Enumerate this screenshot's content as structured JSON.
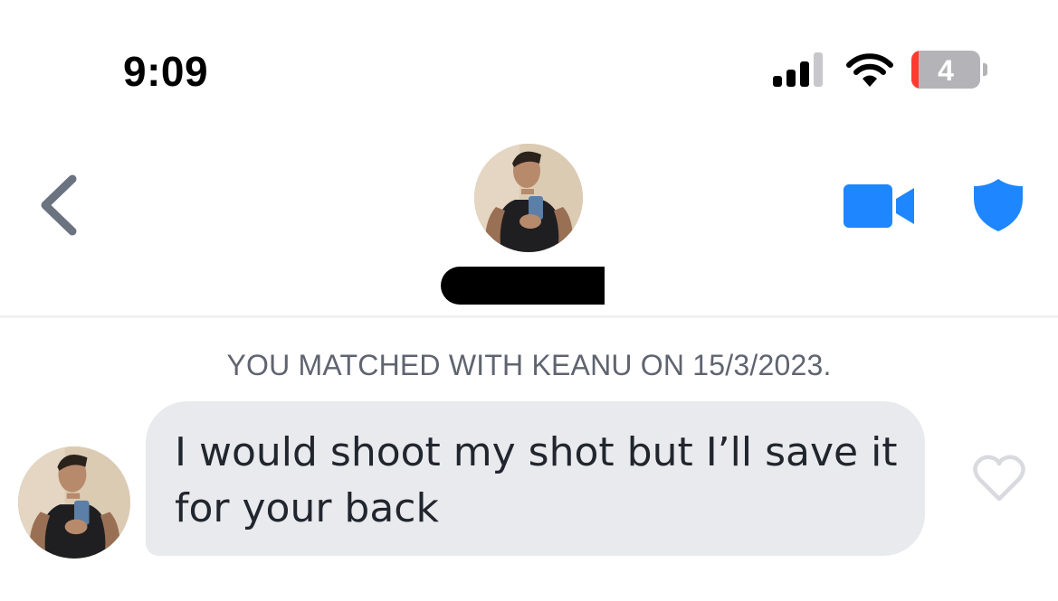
{
  "status_bar": {
    "time": "9:09",
    "battery_level": "4",
    "icons": [
      "cellular-signal-icon",
      "wifi-icon",
      "battery-icon"
    ],
    "signal_bars_active": 3,
    "signal_bars_total": 4
  },
  "header": {
    "back_icon": "chevron-left-icon",
    "avatar": "profile-photo",
    "name": "[redacted]",
    "actions": [
      {
        "icon": "video-camera-icon",
        "color": "#1e86ff"
      },
      {
        "icon": "shield-icon",
        "color": "#1e86ff"
      }
    ]
  },
  "conversation": {
    "match_notice": "YOU MATCHED WITH KEANU ON 15/3/2023.",
    "messages": [
      {
        "sender": "match",
        "text": "I would shoot my shot but I’ll save it for your back",
        "liked": false
      }
    ]
  },
  "colors": {
    "accent": "#1e86ff",
    "bubble": "#e9eaee",
    "chevron": "#6b7280",
    "battery_low": "#ff3b30"
  }
}
